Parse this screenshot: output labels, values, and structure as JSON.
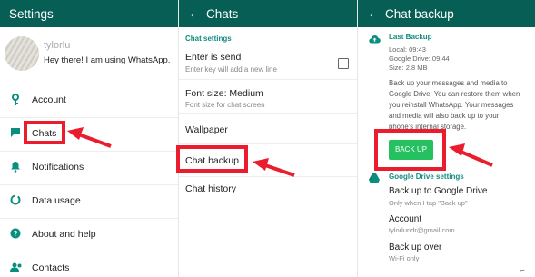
{
  "settings": {
    "title": "Settings",
    "profile_name": "tylorlu",
    "profile_status": "Hey there! I am using WhatsApp.",
    "items": [
      {
        "label": "Account",
        "icon": "key-icon"
      },
      {
        "label": "Chats",
        "icon": "chat-icon"
      },
      {
        "label": "Notifications",
        "icon": "bell-icon"
      },
      {
        "label": "Data usage",
        "icon": "data-usage-icon"
      },
      {
        "label": "About and help",
        "icon": "help-icon"
      },
      {
        "label": "Contacts",
        "icon": "contacts-icon"
      }
    ]
  },
  "chats": {
    "title": "Chats",
    "section": "Chat settings",
    "enter_is_send": {
      "title": "Enter is send",
      "subtitle": "Enter key will add a new line",
      "checked": false
    },
    "font_size": {
      "title": "Font size: Medium",
      "subtitle": "Font size for chat screen"
    },
    "wallpaper": "Wallpaper",
    "chat_backup": "Chat backup",
    "chat_history": "Chat history"
  },
  "backup": {
    "title": "Chat backup",
    "last_backup_header": "Last Backup",
    "local": "Local: 09:43",
    "google_drive": "Google Drive: 09:44",
    "size": "Size: 2.8 MB",
    "description": "Back up your messages and media to Google Drive. You can restore them when you reinstall WhatsApp. Your messages and media will also back up to your phone's internal storage.",
    "button": "BACK UP",
    "drive_settings_header": "Google Drive settings",
    "backup_to_drive": {
      "title": "Back up to Google Drive",
      "subtitle": "Only when I tap \"Back up\""
    },
    "account": {
      "title": "Account",
      "subtitle": "tylorlundr@gmail.com"
    },
    "backup_over": {
      "title": "Back up over",
      "subtitle": "Wi-Fi only"
    }
  },
  "colors": {
    "app_bar": "#075e54",
    "accent": "#128c7e",
    "button": "#25c161",
    "highlight": "#ea1c2d"
  }
}
